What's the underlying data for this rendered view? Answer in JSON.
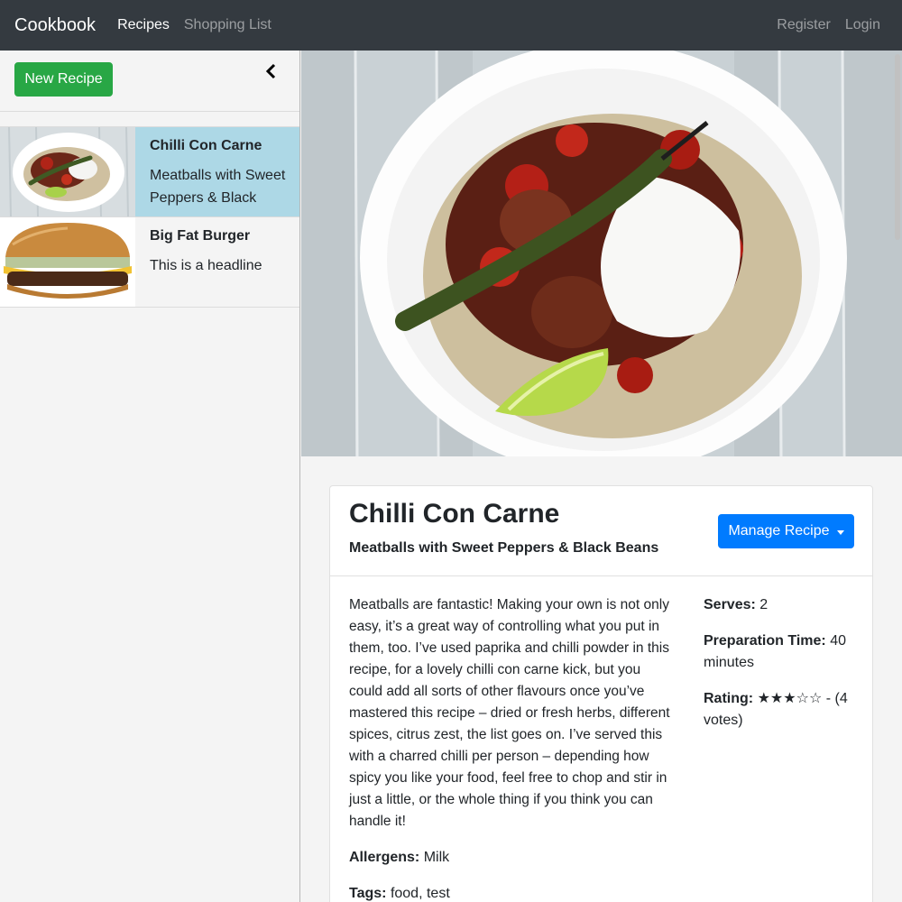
{
  "navbar": {
    "brand": "Cookbook",
    "links": [
      "Recipes",
      "Shopping List"
    ],
    "right_links": [
      "Register",
      "Login"
    ]
  },
  "sidebar": {
    "new_recipe_label": "New Recipe",
    "collapse_icon": "chevron-left-icon",
    "recipes": [
      {
        "title": "Chilli Con Carne",
        "headline": "Meatballs with Sweet Peppers & Black",
        "active": true
      },
      {
        "title": "Big Fat Burger",
        "headline": "This is a headline",
        "active": false
      }
    ]
  },
  "recipe": {
    "title": "Chilli Con Carne",
    "subtitle": "Meatballs with Sweet Peppers & Black Beans",
    "manage_label": "Manage Recipe",
    "description": "Meatballs are fantastic! Making your own is not only easy, it’s a great way of controlling what you put in them, too. I’ve used paprika and chilli powder in this recipe, for a lovely chilli con carne kick, but you could add all sorts of other flavours once you’ve mastered this recipe – dried or fresh herbs, different spices, citrus zest, the list goes on. I’ve served this with a charred chilli per person – depending how spicy you like your food, feel free to chop and stir in just a little, or the whole thing if you think you can handle it!",
    "allergens_label": "Allergens:",
    "allergens": "Milk",
    "tags_label": "Tags:",
    "tags": "food, test",
    "serves_label": "Serves:",
    "serves": "2",
    "prep_label": "Preparation Time:",
    "prep_time": "40 minutes",
    "rating_label": "Rating:",
    "rating_stars": "★★★☆☆",
    "rating_votes": "- (4 votes)",
    "rating_value": 3,
    "rating_max": 5
  },
  "colors": {
    "navbar_bg": "#343a40",
    "active_item_bg": "#add8e6",
    "new_button": "#28a745",
    "manage_button": "#007bff"
  }
}
